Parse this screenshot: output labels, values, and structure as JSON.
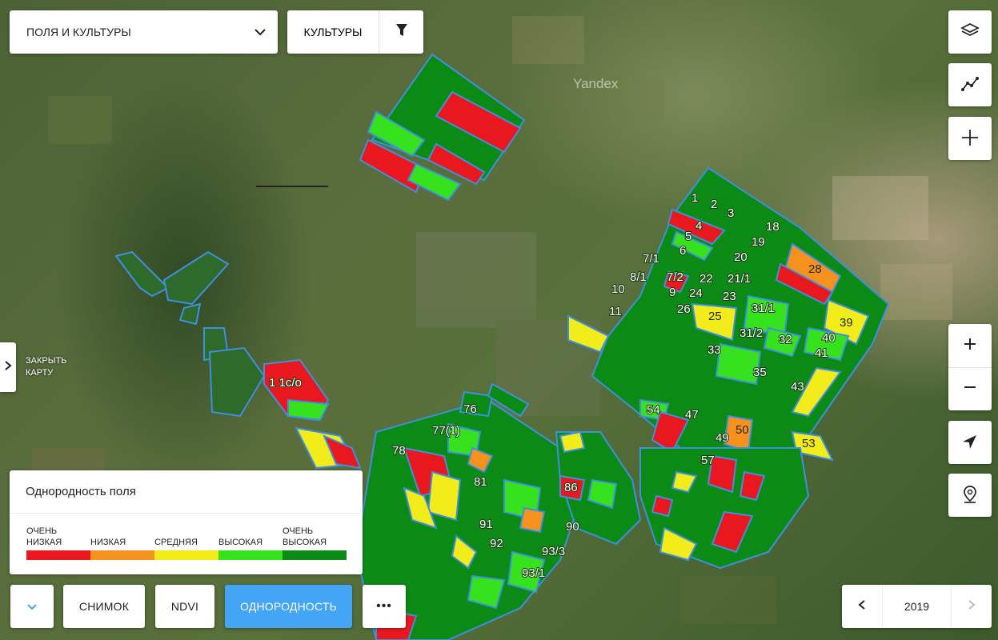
{
  "header": {
    "fields_select_label": "ПОЛЯ И КУЛЬТУРЫ",
    "crops_label": "КУЛЬТУРЫ"
  },
  "map": {
    "watermark": "Yandex",
    "field_labels": [
      "1",
      "2",
      "3",
      "4",
      "5",
      "6",
      "7/1",
      "8/1",
      "7/2",
      "9",
      "10",
      "11",
      "18",
      "19",
      "20",
      "21/1",
      "22",
      "23",
      "24",
      "25",
      "26",
      "28",
      "31/1",
      "31/2",
      "32",
      "33",
      "35",
      "39",
      "40",
      "41",
      "43",
      "47",
      "49",
      "50",
      "53",
      "54",
      "57",
      "76",
      "77(1)",
      "78",
      "81",
      "86",
      "90",
      "91",
      "92",
      "93/3",
      "93/1",
      "1 1с/о"
    ],
    "colors": {
      "very_low": "#e8181e",
      "low": "#f5921e",
      "medium": "#f2ec1a",
      "high": "#36e21e",
      "very_high": "#0c8a16",
      "field_border": "#3f8fe0"
    }
  },
  "side": {
    "close_map_line1": "ЗАКРЫТЬ",
    "close_map_line2": "КАРТУ"
  },
  "legend": {
    "title": "Однородность поля",
    "items": [
      {
        "line1": "ОЧЕНЬ",
        "line2": "НИЗКАЯ",
        "color": "#e8181e"
      },
      {
        "line1": "",
        "line2": "НИЗКАЯ",
        "color": "#f5921e"
      },
      {
        "line1": "",
        "line2": "СРЕДНЯЯ",
        "color": "#f2ec1a"
      },
      {
        "line1": "",
        "line2": "ВЫСОКАЯ",
        "color": "#36e21e"
      },
      {
        "line1": "ОЧЕНЬ",
        "line2": "ВЫСОКАЯ",
        "color": "#0c8a16"
      }
    ]
  },
  "bottom": {
    "snapshot_label": "СНИМОК",
    "ndvi_label": "NDVI",
    "uniformity_label": "ОДНОРОДНОСТЬ",
    "more_label": "•••",
    "year": "2019"
  }
}
